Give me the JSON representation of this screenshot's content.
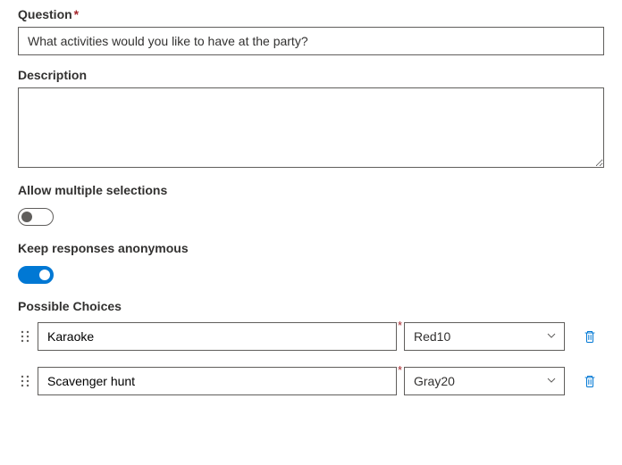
{
  "question": {
    "label": "Question",
    "value": "What activities would you like to have at the party?"
  },
  "description": {
    "label": "Description",
    "value": ""
  },
  "allow_multiple": {
    "label": "Allow multiple selections",
    "on": false
  },
  "anonymous": {
    "label": "Keep responses anonymous",
    "on": true
  },
  "choices": {
    "label": "Possible Choices",
    "items": [
      {
        "text": "Karaoke",
        "color": "Red10"
      },
      {
        "text": "Scavenger hunt",
        "color": "Gray20"
      }
    ]
  },
  "required_mark": "*"
}
